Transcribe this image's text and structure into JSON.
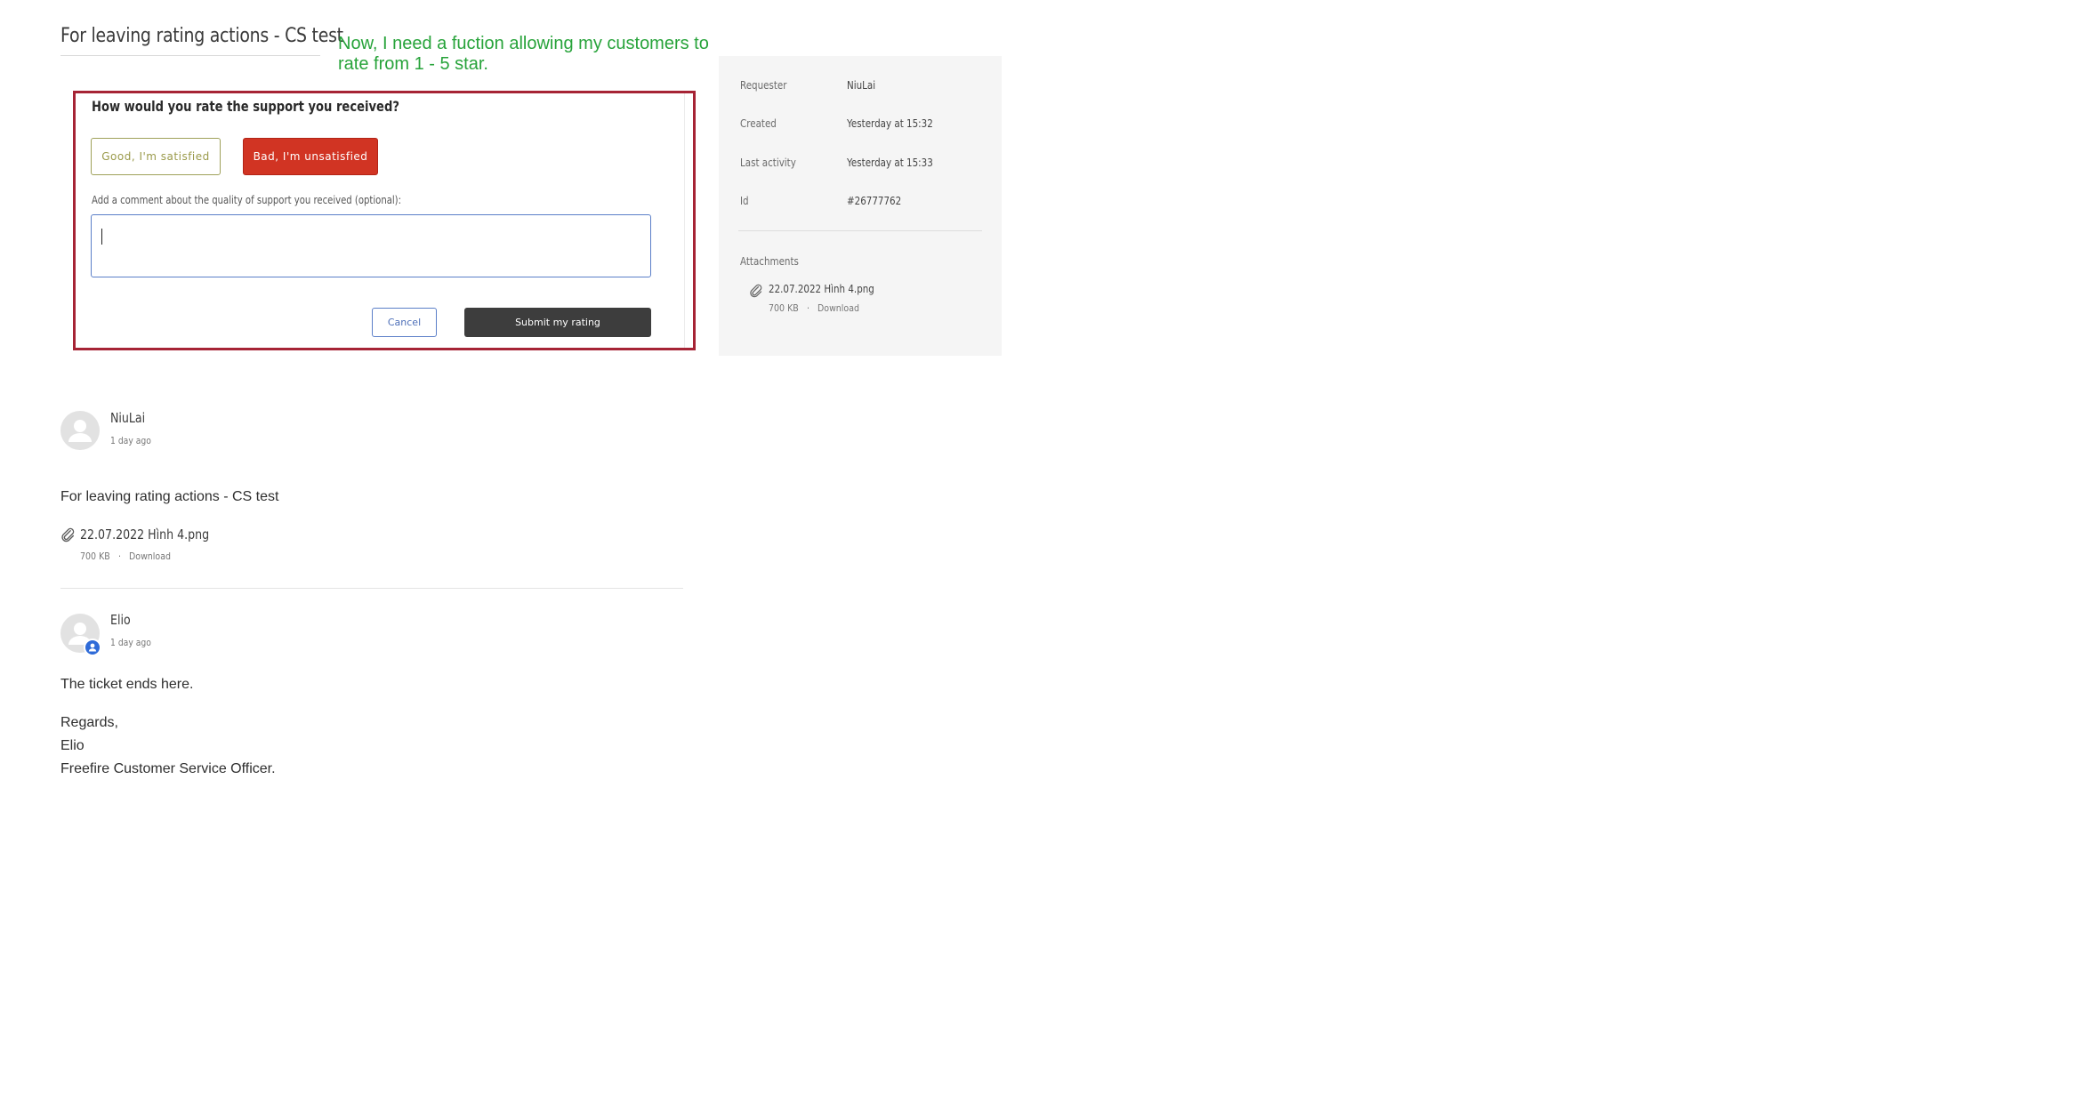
{
  "ticket": {
    "title": "For leaving rating actions - CS test"
  },
  "annotation": {
    "text": "Now, I need a fuction allowing my customers to rate from 1 - 5 star."
  },
  "rating": {
    "question": "How would you rate the support you received?",
    "good_label": "Good, I'm satisfied",
    "bad_label": "Bad, I'm unsatisfied",
    "comment_label": "Add a comment about the quality of support you received (optional):",
    "comment_value": "",
    "cancel_label": "Cancel",
    "submit_label": "Submit my rating"
  },
  "details": {
    "requester_label": "Requester",
    "requester_value": "NiuLai",
    "created_label": "Created",
    "created_value": "Yesterday at 15:32",
    "last_activity_label": "Last activity",
    "last_activity_value": "Yesterday at 15:33",
    "id_label": "Id",
    "id_value": "#26777762",
    "attachments_label": "Attachments",
    "attachment_name": "22.07.2022 Hình 4.png",
    "attachment_size": "700 KB",
    "attachment_separator": "·",
    "attachment_download": "Download"
  },
  "comments": [
    {
      "author": "NiuLai",
      "time": "1 day ago",
      "body": "For leaving rating actions - CS test",
      "attachment_name": "22.07.2022 Hình 4.png",
      "attachment_size": "700 KB",
      "attachment_separator": "·",
      "attachment_download": "Download"
    },
    {
      "author": "Elio",
      "time": "1 day ago",
      "body_lines": [
        "The ticket ends here.",
        "Regards,",
        "Elio",
        "Freefire Customer Service Officer."
      ]
    }
  ],
  "colors": {
    "annotation": "#27a33a",
    "frame_highlight": "#a62435",
    "bad_button": "#d13423",
    "submit_button": "#3d3d3d",
    "agent_badge": "#2f6bd8"
  },
  "icons": {
    "attachment": "paperclip-icon",
    "avatar": "user-avatar-icon",
    "agent": "agent-badge-icon"
  }
}
